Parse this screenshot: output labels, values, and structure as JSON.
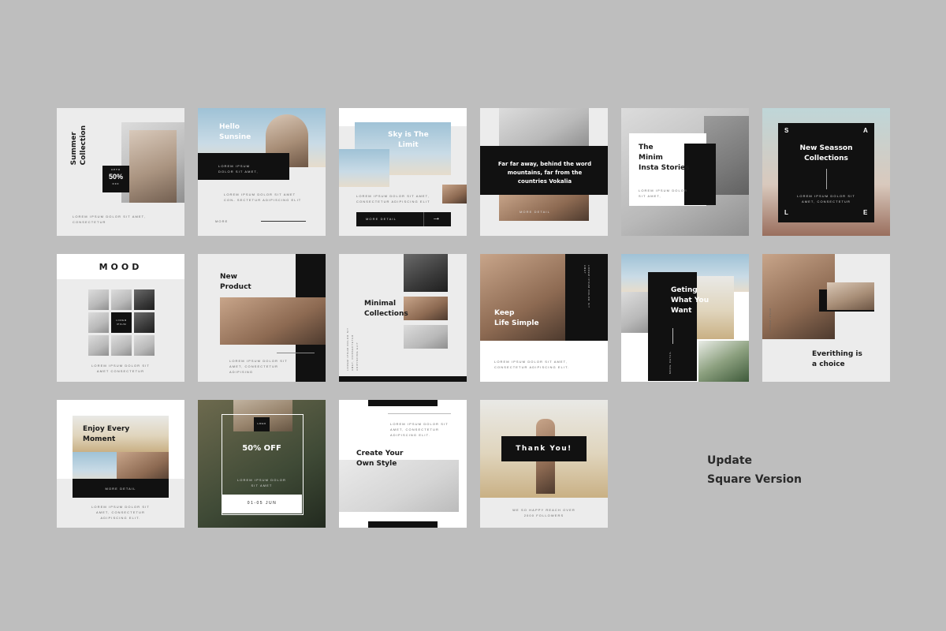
{
  "side_label": {
    "line1": "Update",
    "line2": "Square Version"
  },
  "cards": {
    "c1": {
      "title_line1": "Summer",
      "title_line2": "Collection",
      "badge_top": "UPTO",
      "badge_value": "50%",
      "badge_bottom": "OFF",
      "body": "LOREM IPSUM DOLOR SIT AMET, CONSECTETUR"
    },
    "c2": {
      "title_line1": "Hello",
      "title_line2": "Sunsine",
      "body_line1": "LOREM IPSUM",
      "body_line2": "DOLOR SIT AMET,",
      "footer": "LOREM IPSUM DOLOR SIT AMET CON- SECTETUR ADIPISCING ELIT",
      "more": "MORE"
    },
    "c3": {
      "title_line1": "Sky is The",
      "title_line2": "Limit",
      "body": "LOREM IPSUM DOLOR SIT AMET, CONSECTETUR ADIPISCING ELIT",
      "button": "MORE DETAIL",
      "arrow": "→"
    },
    "c4": {
      "body": "Far far away, behind the word mountains, far from the countries Vokalia",
      "button": "MORE DETAIL"
    },
    "c5": {
      "line1": "The",
      "line2": "Minim",
      "line3": "Insta Stories",
      "body": "LOREM IPSUM DOLOR SIT AMET,"
    },
    "c6": {
      "title_line1": "New Seasson",
      "title_line2": "Collections",
      "body": "LOREM IPSUM DOLOR SIT AMET, CONSECTETUR",
      "s": "S",
      "a": "A",
      "l": "L",
      "e": "E"
    },
    "c7": {
      "title": "MOOD",
      "center_line1": "LOREM",
      "center_line2": "IPSUM",
      "body": "LOREM IPSUM DOLOR SIT AMET CONSECTETUR"
    },
    "c8": {
      "title_line1": "New",
      "title_line2": "Product",
      "body": "LOREM IPSUM DOLOR SIT AMET, CONSECTETUR ADIPISING"
    },
    "c9": {
      "title_line1": "Minimal",
      "title_line2": "Collections",
      "side": "LOREM IPSUM DOLOR SIT AMET, CONSECTETUR ADIPISCING ELIT"
    },
    "c10": {
      "title_line1": "Keep",
      "title_line2": "Life Simple",
      "body": "LOREM IPSUM DOLOR SIT AMET, CONSECTETUR ADIPISCING ELIT.",
      "side": "LOREM IPSUM DOLOR SIT AMET"
    },
    "c11": {
      "title_line1": "Geting",
      "title_line2": "What You",
      "title_line3": "Want",
      "side": "MORE DETAIL"
    },
    "c12": {
      "title_line1": "Everithing is",
      "title_line2": "a choice",
      "side": "LOREM IPSUM"
    },
    "c13": {
      "title_line1": "Enjoy Every",
      "title_line2": "Moment",
      "button": "MORE DETAIL",
      "body": "LOREM IPSUM DOLOR SIT AMET, CONSECTETUR ADIPISCING ELIT."
    },
    "c14": {
      "logo": "LOGO",
      "title": "50% OFF",
      "body": "LOREM IPSUM DOLOR SIT AMET",
      "date": "01-05 JUN"
    },
    "c15": {
      "title_line1": "Create Your",
      "title_line2": "Own Style",
      "body": "LOREM IPSUM DOLOR SIT AMET, CONSECTETUR ADIPISCING ELIT."
    },
    "c16": {
      "title": "Thank You!",
      "body_line1": "WE SO HAPPY REACH OVER",
      "body_line2": "2000 FOLLOWERS"
    }
  },
  "colors": {
    "background": "#bebebe",
    "card": "#ececec",
    "accent": "#111111"
  }
}
